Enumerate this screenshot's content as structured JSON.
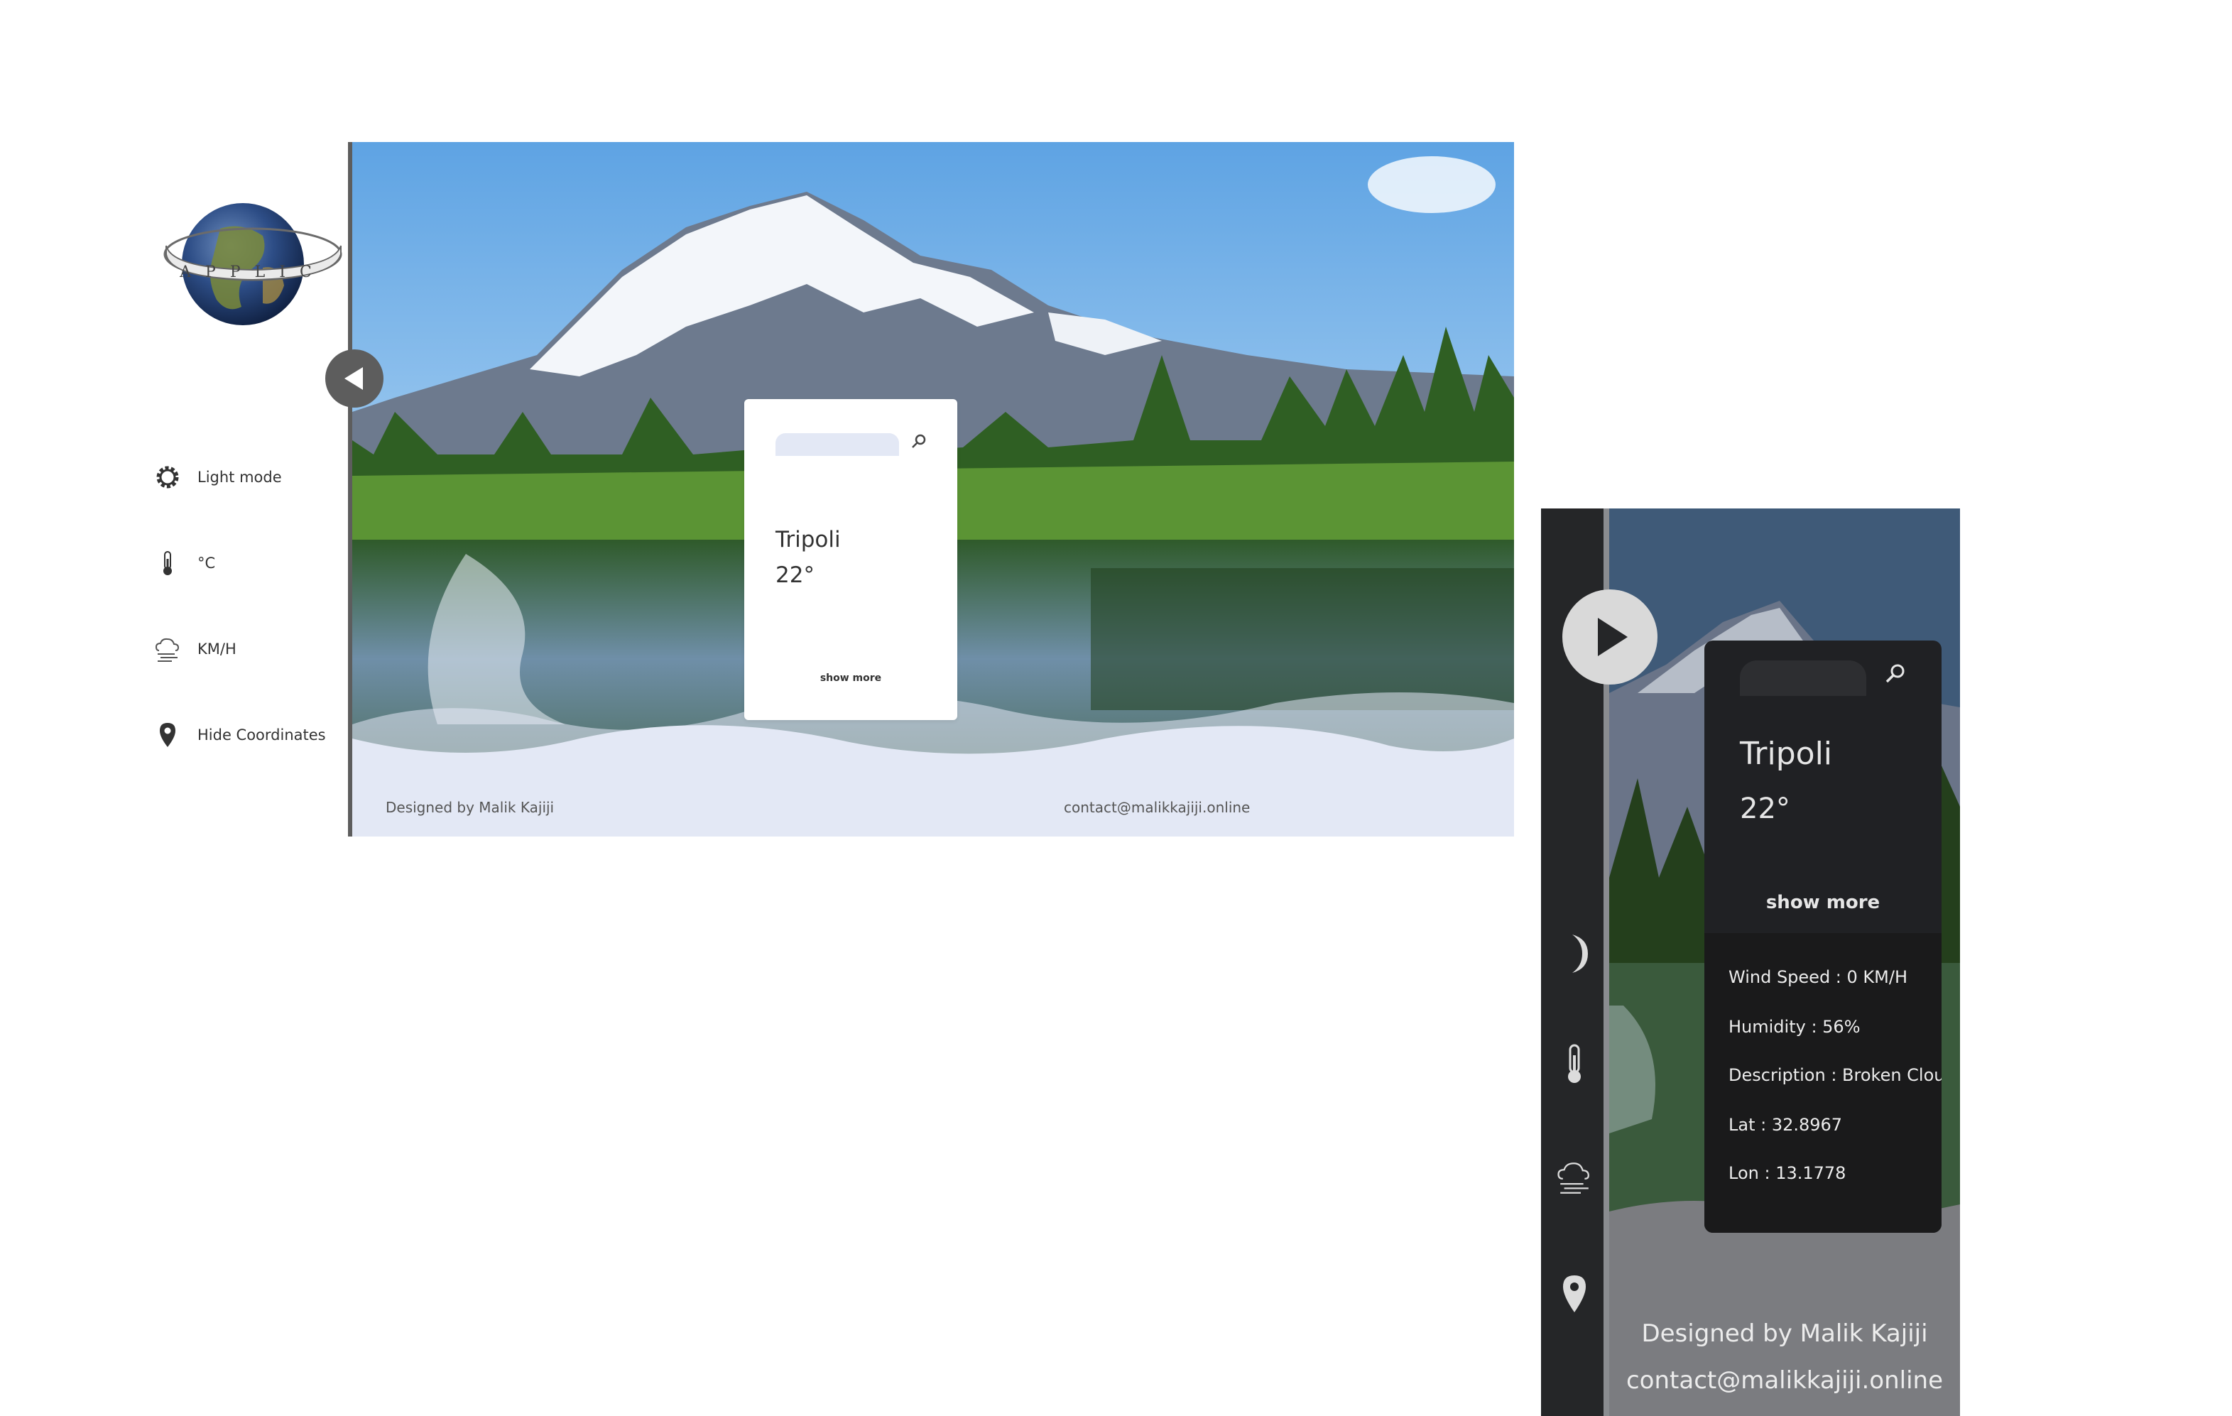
{
  "desktop": {
    "logo_text": "APPLIC",
    "sidebar": {
      "items": [
        {
          "label": "Light mode",
          "icon": "gear-icon"
        },
        {
          "label": "°C",
          "icon": "thermometer-icon"
        },
        {
          "label": "KM/H",
          "icon": "wind-cloud-icon"
        },
        {
          "label": "Hide Coordinates",
          "icon": "location-pin-icon"
        }
      ]
    },
    "card": {
      "search_value": "",
      "city": "Tripoli",
      "temp": "22°",
      "show_more": "show more"
    },
    "footer": {
      "designer": "Designed by Malik Kajiji",
      "contact": "contact@malikkajiji.online"
    }
  },
  "mobile": {
    "card": {
      "search_value": "",
      "city": "Tripoli",
      "temp": "22°",
      "show_more": "show more"
    },
    "details": [
      "Wind Speed : 0 KM/H",
      "Humidity : 56%",
      "Description : Broken Clouds",
      "Lat : 32.8967",
      "Lon : 13.1778"
    ],
    "footer": {
      "designer": "Designed by Malik Kajiji",
      "contact": "contact@malikkajiji.online"
    }
  },
  "colors": {
    "sidebar_divider": "#5d5d5d",
    "wave": "#e3e8f5",
    "dark_card": "#202124",
    "dark_rail": "#252628"
  }
}
